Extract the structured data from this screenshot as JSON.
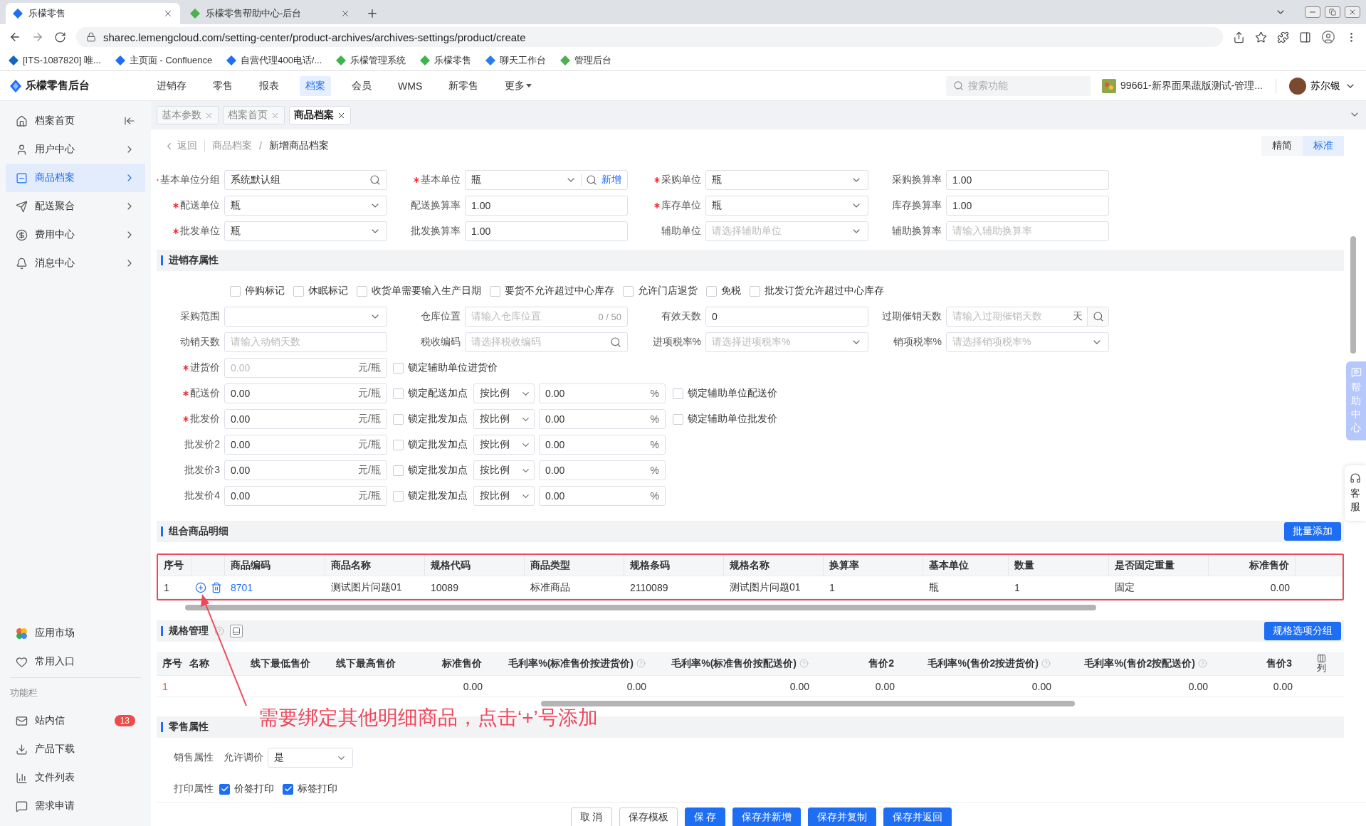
{
  "browser": {
    "tabs": [
      {
        "title": "乐檬零售",
        "selected": true
      },
      {
        "title": "乐檬零售帮助中心-后台",
        "selected": false
      }
    ],
    "url": "sharec.lemengcloud.com/setting-center/product-archives/archives-settings/product/create",
    "bookmarks": [
      "[ITS-1087820] 唯...",
      "主页面 - Confluence",
      "自营代理400电话/...",
      "乐檬管理系统",
      "乐檬零售",
      "聊天工作台",
      "管理后台"
    ]
  },
  "header": {
    "brand": "乐檬零售后台",
    "nav": [
      {
        "label": "进销存",
        "selected": false,
        "dropdown": false
      },
      {
        "label": "零售",
        "selected": false,
        "dropdown": false
      },
      {
        "label": "报表",
        "selected": false,
        "dropdown": false
      },
      {
        "label": "档案",
        "selected": true,
        "dropdown": false
      },
      {
        "label": "会员",
        "selected": false,
        "dropdown": false
      },
      {
        "label": "WMS",
        "selected": false,
        "dropdown": false
      },
      {
        "label": "新零售",
        "selected": false,
        "dropdown": false
      },
      {
        "label": "更多",
        "selected": false,
        "dropdown": true
      }
    ],
    "search_placeholder": "搜索功能",
    "store": "99661-新界面果蔬版测试-管理...",
    "user": "苏尔银"
  },
  "sidebar": {
    "items": [
      {
        "label": "档案首页",
        "kind": "collapse",
        "selected": false
      },
      {
        "label": "用户中心",
        "kind": "menu",
        "selected": false
      },
      {
        "label": "商品档案",
        "kind": "menu",
        "selected": true
      },
      {
        "label": "配送聚合",
        "kind": "menu",
        "selected": false
      },
      {
        "label": "费用中心",
        "kind": "menu",
        "selected": false
      },
      {
        "label": "消息中心",
        "kind": "menu",
        "selected": false
      }
    ],
    "shortcuts": [
      "应用市场",
      "常用入口"
    ],
    "section_title": "功能栏",
    "tools": [
      {
        "label": "站内信",
        "badge": "13"
      },
      {
        "label": "产品下载"
      },
      {
        "label": "文件列表"
      },
      {
        "label": "需求申请"
      }
    ]
  },
  "page_tabs": [
    {
      "label": "基本参数",
      "selected": false
    },
    {
      "label": "档案首页",
      "selected": false
    },
    {
      "label": "商品档案",
      "selected": true
    }
  ],
  "breadcrumb": {
    "back": "返回",
    "separator": "/",
    "items": [
      "商品档案",
      "新增商品档案"
    ]
  },
  "view_modes": [
    {
      "label": "精简",
      "selected": false
    },
    {
      "label": "标准",
      "selected": true
    }
  ],
  "unit_fields": [
    {
      "label": "基本单位分组",
      "required": true,
      "kind": "search",
      "value": "系统默认组"
    },
    {
      "label": "基本单位",
      "required": true,
      "kind": "unit",
      "value": "瓶",
      "action": "新增"
    },
    {
      "label": "采购单位",
      "required": true,
      "kind": "select",
      "value": "瓶"
    },
    {
      "label": "采购换算率",
      "required": false,
      "kind": "input",
      "value": "1.00"
    },
    {
      "label": "配送单位",
      "required": true,
      "kind": "select",
      "value": "瓶"
    },
    {
      "label": "配送换算率",
      "required": false,
      "kind": "input",
      "value": "1.00"
    },
    {
      "label": "库存单位",
      "required": true,
      "kind": "select",
      "value": "瓶"
    },
    {
      "label": "库存换算率",
      "required": false,
      "kind": "input",
      "value": "1.00"
    },
    {
      "label": "批发单位",
      "required": true,
      "kind": "select",
      "value": "瓶"
    },
    {
      "label": "批发换算率",
      "required": false,
      "kind": "input",
      "value": "1.00"
    },
    {
      "label": "辅助单位",
      "required": false,
      "kind": "select",
      "placeholder": "请选择辅助单位"
    },
    {
      "label": "辅助换算率",
      "required": false,
      "kind": "input",
      "placeholder": "请输入辅助换算率"
    }
  ],
  "inventory": {
    "title": "进销存属性",
    "flags": [
      {
        "label": "停购标记",
        "checked": false
      },
      {
        "label": "休眠标记",
        "checked": false
      },
      {
        "label": "收货单需要输入生产日期",
        "checked": false
      },
      {
        "label": "要货不允许超过中心库存",
        "checked": false
      },
      {
        "label": "允许门店退货",
        "checked": false
      },
      {
        "label": "免税",
        "checked": false
      },
      {
        "label": "批发订货允许超过中心库存",
        "checked": false
      }
    ],
    "fields": [
      {
        "label": "采购范围",
        "required": false,
        "kind": "select"
      },
      {
        "label": "仓库位置",
        "required": false,
        "kind": "input",
        "placeholder": "请输入仓库位置",
        "count": "0 / 50"
      },
      {
        "label": "有效天数",
        "required": false,
        "kind": "input",
        "value": "0"
      },
      {
        "label": "过期催销天数",
        "required": false,
        "kind": "addon",
        "placeholder": "请输入过期催销天数",
        "suffix": "天"
      },
      {
        "label": "动销天数",
        "required": false,
        "kind": "input",
        "placeholder": "请输入动销天数"
      },
      {
        "label": "税收编码",
        "required": false,
        "kind": "search",
        "placeholder": "请选择税收编码"
      },
      {
        "label": "进项税率%",
        "required": false,
        "kind": "select",
        "placeholder": "请选择进项税率%"
      },
      {
        "label": "销项税率%",
        "required": false,
        "kind": "select",
        "placeholder": "请选择销项税率%"
      }
    ],
    "prices": [
      {
        "label": "进货价",
        "required": true,
        "placeholder": "0.00",
        "unit": "元/瓶",
        "lock": {
          "label": "锁定辅助单位进货价",
          "checked": false
        }
      },
      {
        "label": "配送价",
        "required": true,
        "value": "0.00",
        "unit": "元/瓶",
        "lock": {
          "label": "锁定配送加点",
          "checked": false
        },
        "markup": {
          "mode": "按比例",
          "value": "0.00",
          "unit": "%"
        },
        "aux_lock": {
          "label": "锁定辅助单位配送价",
          "checked": false
        }
      },
      {
        "label": "批发价",
        "required": true,
        "value": "0.00",
        "unit": "元/瓶",
        "lock": {
          "label": "锁定批发加点",
          "checked": false
        },
        "markup": {
          "mode": "按比例",
          "value": "0.00",
          "unit": "%"
        },
        "aux_lock": {
          "label": "锁定辅助单位批发价",
          "checked": false
        }
      },
      {
        "label": "批发价2",
        "required": false,
        "value": "0.00",
        "unit": "元/瓶",
        "lock": {
          "label": "锁定批发加点",
          "checked": false
        },
        "markup": {
          "mode": "按比例",
          "value": "0.00",
          "unit": "%"
        }
      },
      {
        "label": "批发价3",
        "required": false,
        "value": "0.00",
        "unit": "元/瓶",
        "lock": {
          "label": "锁定批发加点",
          "checked": false
        },
        "markup": {
          "mode": "按比例",
          "value": "0.00",
          "unit": "%"
        }
      },
      {
        "label": "批发价4",
        "required": false,
        "value": "0.00",
        "unit": "元/瓶",
        "lock": {
          "label": "锁定批发加点",
          "checked": false
        },
        "markup": {
          "mode": "按比例",
          "value": "0.00",
          "unit": "%"
        }
      }
    ]
  },
  "combo": {
    "title": "组合商品明细",
    "button": "批量添加",
    "highlighted": true,
    "columns": [
      {
        "label": "序号",
        "kind": "text"
      },
      {
        "label": "商品编码",
        "kind": "link"
      },
      {
        "label": "商品名称",
        "kind": "text"
      },
      {
        "label": "规格代码",
        "kind": "text"
      },
      {
        "label": "商品类型",
        "kind": "text"
      },
      {
        "label": "规格条码",
        "kind": "text"
      },
      {
        "label": "规格名称",
        "kind": "text"
      },
      {
        "label": "换算率",
        "kind": "text"
      },
      {
        "label": "基本单位",
        "kind": "text"
      },
      {
        "label": "数量",
        "kind": "text"
      },
      {
        "label": "是否固定重量",
        "kind": "text"
      },
      {
        "label": "标准售价",
        "kind": "number"
      }
    ],
    "rows": [
      {
        "cells": [
          "1",
          "8701",
          "测试图片问题01",
          "10089",
          "标准商品",
          "2110089",
          "测试图片问题01",
          "1",
          "瓶",
          "1",
          "固定",
          "0.00"
        ]
      }
    ]
  },
  "spec": {
    "title": "规格管理",
    "help": true,
    "button": "规格选项分组",
    "column_settings": "列",
    "columns": [
      {
        "label": "序号",
        "kind": "serial",
        "help": false
      },
      {
        "label": "名称",
        "kind": "text",
        "help": false
      },
      {
        "label": "线下最低售价",
        "kind": "number",
        "help": false
      },
      {
        "label": "线下最高售价",
        "kind": "number",
        "help": false
      },
      {
        "label": "标准售价",
        "kind": "number",
        "help": false
      },
      {
        "label": "毛利率%(标准售价按进货价)",
        "kind": "number",
        "help": true
      },
      {
        "label": "毛利率%(标准售价按配送价)",
        "kind": "number",
        "help": true
      },
      {
        "label": "售价2",
        "kind": "number",
        "help": false
      },
      {
        "label": "毛利率%(售价2按进货价)",
        "kind": "number",
        "help": true
      },
      {
        "label": "毛利率%(售价2按配送价)",
        "kind": "number",
        "help": true
      },
      {
        "label": "售价3",
        "kind": "number",
        "help": false
      }
    ],
    "rows": [
      {
        "cells": [
          "1",
          null,
          null,
          null,
          "0.00",
          "0.00",
          "0.00",
          "0.00",
          "0.00",
          "0.00",
          "0.00"
        ]
      }
    ]
  },
  "retail": {
    "title": "零售属性",
    "sale": {
      "label": "销售属性",
      "field_label": "允许调价",
      "value": "是"
    },
    "print": {
      "label": "打印属性",
      "options": [
        {
          "label": "价签打印",
          "checked": true
        },
        {
          "label": "标签打印",
          "checked": true
        }
      ]
    }
  },
  "footer_buttons": [
    {
      "label": "取 消",
      "kind": "default"
    },
    {
      "label": "保存模板",
      "kind": "default"
    },
    {
      "label": "保 存",
      "kind": "primary"
    },
    {
      "label": "保存并新增",
      "kind": "primary"
    },
    {
      "label": "保存并复制",
      "kind": "primary"
    },
    {
      "label": "保存并返回",
      "kind": "primary"
    }
  ],
  "floating": {
    "help": "帮助中心",
    "service": "客服"
  },
  "annotation": {
    "text": "需要绑定其他明细商品，点击‘+’号添加"
  }
}
